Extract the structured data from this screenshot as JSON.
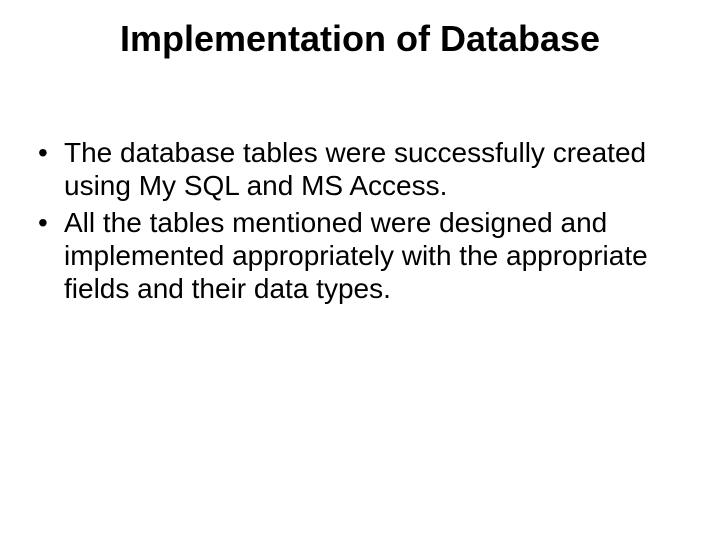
{
  "title": "Implementation of Database",
  "bullets": [
    "The database tables were successfully created using My SQL and MS Access.",
    "All the tables mentioned were designed and implemented appropriately with the appropriate fields and their data types."
  ]
}
